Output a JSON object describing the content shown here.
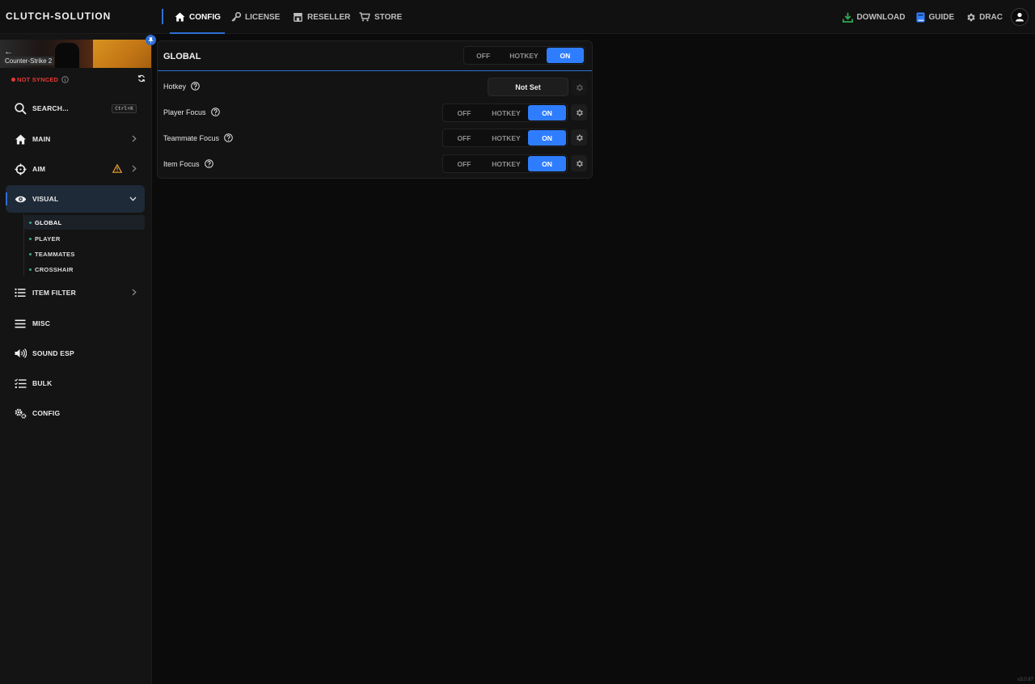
{
  "app": {
    "brand": "CLUTCH-SOLUTION",
    "version": "v3.0.87"
  },
  "topnav": {
    "items": [
      {
        "label": "CONFIG",
        "icon": "home-icon",
        "active": true
      },
      {
        "label": "LICENSE",
        "icon": "key-icon",
        "active": false
      },
      {
        "label": "RESELLER",
        "icon": "store-icon",
        "active": false
      },
      {
        "label": "STORE",
        "icon": "cart-icon",
        "active": false
      }
    ],
    "right": {
      "download": "DOWNLOAD",
      "guide": "GUIDE",
      "user": "DRAC"
    }
  },
  "sidebar": {
    "game": "Counter-Strike 2",
    "sync_status": "NOT SYNCED",
    "search": {
      "label": "SEARCH...",
      "shortcut": "Ctrl+K"
    },
    "items": [
      {
        "label": "MAIN",
        "icon": "home-icon"
      },
      {
        "label": "AIM",
        "icon": "crosshair-icon",
        "warning": true
      },
      {
        "label": "VISUAL",
        "icon": "eye-icon",
        "active": true,
        "expanded": true
      },
      {
        "label": "ITEM FILTER",
        "icon": "list-icon"
      },
      {
        "label": "MISC",
        "icon": "menu-icon"
      },
      {
        "label": "SOUND ESP",
        "icon": "speaker-icon"
      },
      {
        "label": "BULK",
        "icon": "checklist-icon"
      },
      {
        "label": "CONFIG",
        "icon": "gears-icon"
      }
    ],
    "visual_sub": [
      {
        "label": "GLOBAL",
        "active": true
      },
      {
        "label": "PLAYER"
      },
      {
        "label": "TEAMMATES"
      },
      {
        "label": "CROSSHAIR"
      }
    ]
  },
  "panel": {
    "title": "GLOBAL",
    "mode": {
      "options": [
        "OFF",
        "HOTKEY",
        "ON"
      ],
      "selected": "ON"
    },
    "rows": [
      {
        "label": "Hotkey",
        "type": "hotkey",
        "value": "Not Set"
      },
      {
        "label": "Player Focus",
        "type": "toggle",
        "options": [
          "OFF",
          "HOTKEY",
          "ON"
        ],
        "selected": "ON"
      },
      {
        "label": "Teammate Focus",
        "type": "toggle",
        "options": [
          "OFF",
          "HOTKEY",
          "ON"
        ],
        "selected": "ON"
      },
      {
        "label": "Item Focus",
        "type": "toggle",
        "options": [
          "OFF",
          "HOTKEY",
          "ON"
        ],
        "selected": "ON"
      }
    ]
  },
  "colors": {
    "accent": "#2f7dff",
    "warning": "#f0a030",
    "error": "#e53935",
    "download": "#2fa84f",
    "guide": "#2f7dff"
  }
}
